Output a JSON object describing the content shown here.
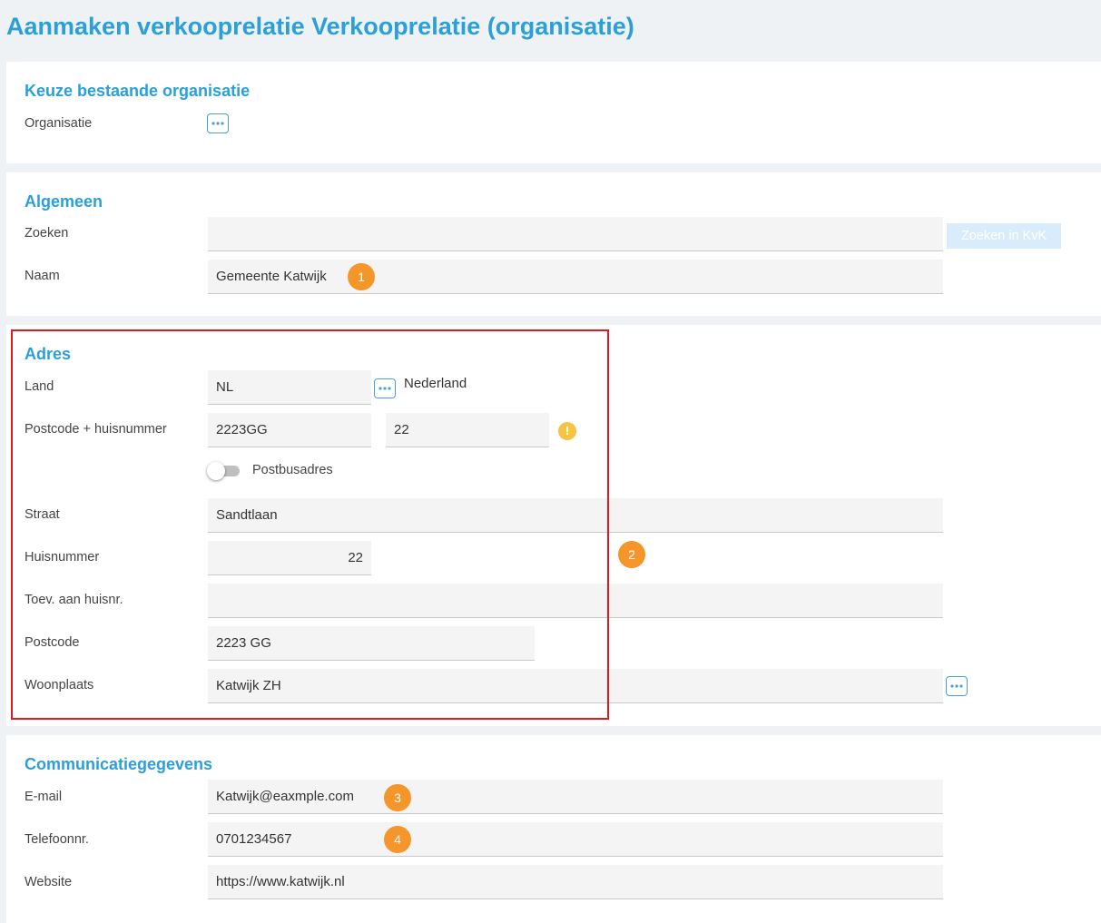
{
  "page": {
    "title": "Aanmaken verkooprelatie Verkooprelatie (organisatie)"
  },
  "sections": {
    "existing": {
      "title": "Keuze bestaande organisatie",
      "organisation_label": "Organisatie"
    },
    "general": {
      "title": "Algemeen",
      "search_label": "Zoeken",
      "search_value": "",
      "kvk_button": "Zoeken in KvK",
      "name_label": "Naam",
      "name_value": "Gemeente Katwijk",
      "badge": "1"
    },
    "address": {
      "title": "Adres",
      "country_label": "Land",
      "country_code": "NL",
      "country_name": "Nederland",
      "postcode_number_label": "Postcode + huisnummer",
      "postcode_lookup": "2223GG",
      "number_lookup": "22",
      "warning_glyph": "!",
      "pobox_label": "Postbusadres",
      "pobox_enabled": false,
      "street_label": "Straat",
      "street_value": "Sandtlaan",
      "housenumber_label": "Huisnummer",
      "housenumber_value": "22",
      "addition_label": "Toev. aan huisnr.",
      "addition_value": "",
      "postcode_label": "Postcode",
      "postcode_value": "2223 GG",
      "city_label": "Woonplaats",
      "city_value": "Katwijk ZH",
      "badge": "2"
    },
    "communication": {
      "title": "Communicatiegegevens",
      "email_label": "E-mail",
      "email_value": "Katwijk@eaxmple.com",
      "email_badge": "3",
      "phone_label": "Telefoonnr.",
      "phone_value": "0701234567",
      "phone_badge": "4",
      "website_label": "Website",
      "website_value": "https://www.katwijk.nl"
    }
  },
  "colors": {
    "title_blue": "#2a9fd8",
    "badge_orange": "#f5962a",
    "warning_yellow": "#f6c342",
    "highlight_red": "#e0191e",
    "kvk_button_bg": "#d9ecfb"
  }
}
